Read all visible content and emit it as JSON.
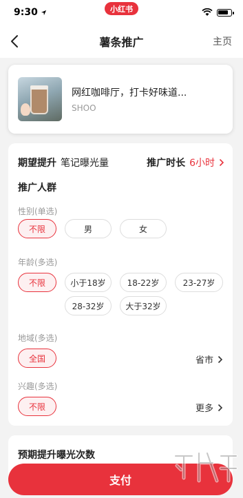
{
  "status_bar": {
    "time": "9:30",
    "app_badge": "小红书",
    "battery_level": 0.8
  },
  "nav": {
    "title": "薯条推广",
    "home_label": "主页"
  },
  "note": {
    "title": "网红咖啡厅，打卡好味道...",
    "author": "SHOO"
  },
  "goal": {
    "label": "期望提升",
    "value": "笔记曝光量",
    "duration_label": "推广时长",
    "duration_value": "6小时"
  },
  "audience": {
    "title": "推广人群",
    "gender": {
      "label": "性别(单选)",
      "options": [
        "不限",
        "男",
        "女"
      ],
      "selected": "不限"
    },
    "age": {
      "label": "年龄(多选)",
      "options": [
        "不限",
        "小于18岁",
        "18-22岁",
        "23-27岁",
        "28-32岁",
        "大于32岁"
      ],
      "selected": "不限"
    },
    "region": {
      "label": "地域(多选)",
      "selected": "全国",
      "more": "省市"
    },
    "interest": {
      "label": "兴趣(多选)",
      "selected": "不限",
      "more": "更多"
    }
  },
  "bottom_section_title": "预期提升曝光次数",
  "pay_button": "支付",
  "colors": {
    "accent": "#e8323c",
    "card": "#ffffff",
    "background": "#f3f3f3"
  },
  "icons": [
    "location-arrow-icon",
    "wifi-icon",
    "battery-icon",
    "back-arrow-icon",
    "chevron-right-icon"
  ]
}
